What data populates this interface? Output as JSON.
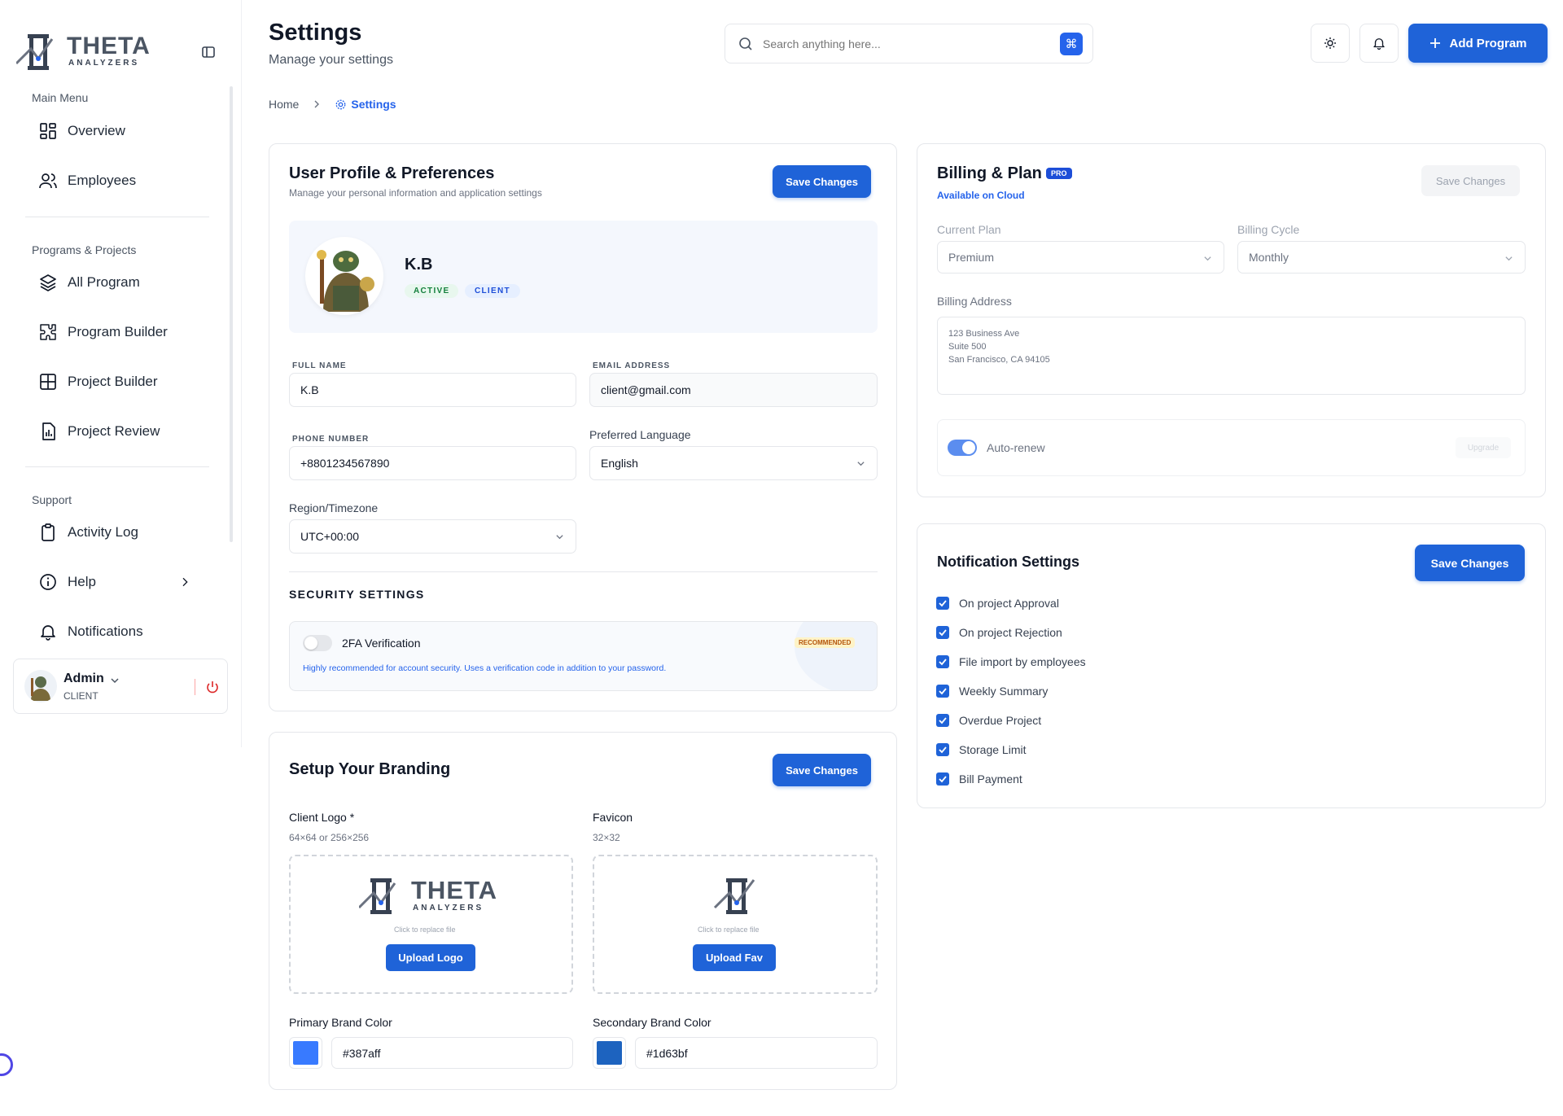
{
  "app": {
    "logo_text_top": "THETA",
    "logo_text_bottom": "ANALYZERS"
  },
  "sidebar": {
    "sections": {
      "main": "Main Menu",
      "programs": "Programs & Projects",
      "support": "Support"
    },
    "items": {
      "overview": "Overview",
      "employees": "Employees",
      "all_program": "All Program",
      "program_builder": "Program Builder",
      "project_builder": "Project Builder",
      "project_review": "Project Review",
      "activity_log": "Activity Log",
      "help": "Help",
      "notifications": "Notifications"
    },
    "user": {
      "name": "Admin",
      "role": "CLIENT"
    }
  },
  "header": {
    "title": "Settings",
    "subtitle": "Manage your settings",
    "search_placeholder": "Search anything here...",
    "search_shortcut": "⌘",
    "add_button": "Add Program"
  },
  "breadcrumb": {
    "home": "Home",
    "current": "Settings"
  },
  "profile": {
    "title": "User Profile & Preferences",
    "subtitle": "Manage your personal information and application settings",
    "save": "Save Changes",
    "name": "K.B",
    "badge_status": "ACTIVE",
    "badge_role": "CLIENT",
    "full_name_label": "FULL NAME",
    "full_name": "K.B",
    "email_label": "EMAIL ADDRESS",
    "email": "client@gmail.com",
    "phone_label": "PHONE NUMBER",
    "phone": "+8801234567890",
    "language_label": "Preferred Language",
    "language": "English",
    "region_label": "Region/Timezone",
    "region": "UTC+00:00",
    "security_title": "SECURITY SETTINGS",
    "twofa_label": "2FA Verification",
    "twofa_badge": "RECOMMENDED",
    "twofa_desc": "Highly recommended for account security. Uses a verification code in addition to your password."
  },
  "branding": {
    "title": "Setup Your Branding",
    "save": "Save Changes",
    "logo_label": "Client Logo *",
    "logo_size": "64×64 or 256×256",
    "favicon_label": "Favicon",
    "favicon_size": "32×32",
    "replace_hint": "Click to replace file",
    "upload_logo": "Upload Logo",
    "upload_fav": "Upload Fav",
    "primary_label": "Primary Brand Color",
    "primary_value": "#387aff",
    "secondary_label": "Secondary Brand Color",
    "secondary_value": "#1d63bf"
  },
  "billing": {
    "title": "Billing & Plan",
    "badge": "PRO",
    "sub": "Available on Cloud",
    "save": "Save Changes",
    "plan_label": "Current Plan",
    "plan": "Premium",
    "cycle_label": "Billing Cycle",
    "cycle": "Monthly",
    "address_label": "Billing Address",
    "address_lines": [
      "123 Business Ave",
      "Suite 500",
      "San Francisco, CA 94105"
    ],
    "autorenew": "Auto-renew",
    "upgrade": "Upgrade"
  },
  "notifications": {
    "title": "Notification Settings",
    "save": "Save Changes",
    "items": [
      "On project Approval",
      "On project Rejection",
      "File import by employees",
      "Weekly Summary",
      "Overdue Project",
      "Storage Limit",
      "Bill Payment"
    ]
  },
  "colors": {
    "accent": "#1f63d8",
    "primary_brand": "#387aff",
    "secondary_brand": "#1d63bf"
  }
}
